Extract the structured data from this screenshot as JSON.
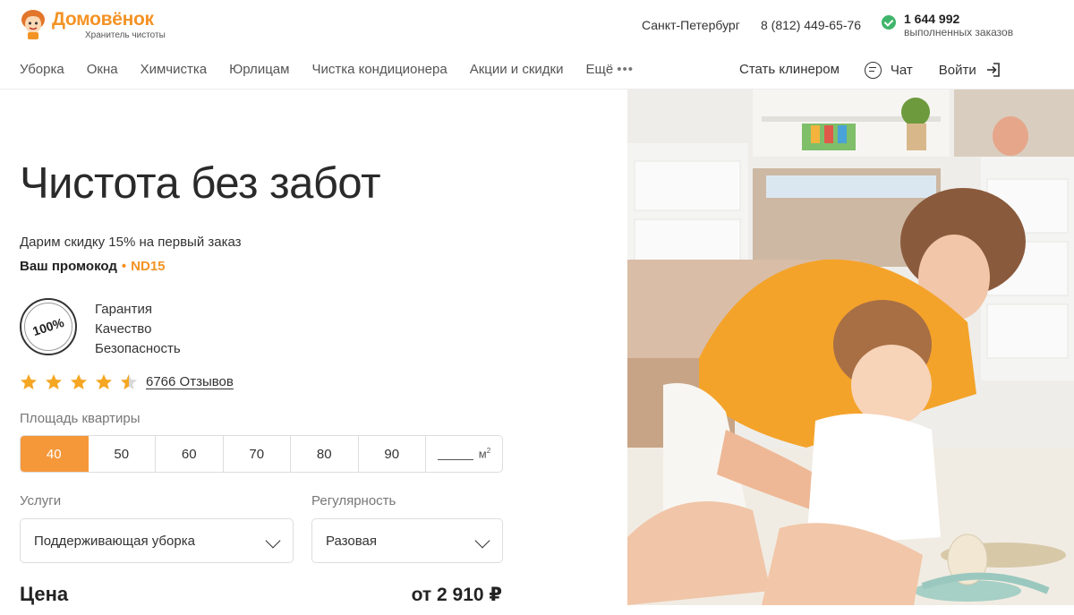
{
  "header": {
    "logo_name": "Домовёнок",
    "logo_tagline": "Хранитель чистоты",
    "city": "Санкт-Петербург",
    "phone": "8 (812) 449-65-76",
    "orders_count": "1 644 992",
    "orders_label": "выполненных заказов"
  },
  "nav": {
    "items": [
      "Уборка",
      "Окна",
      "Химчистка",
      "Юрлицам",
      "Чистка кондиционера",
      "Акции и скидки"
    ],
    "more_label": "Ещё",
    "become_cleaner": "Стать клинером",
    "chat": "Чат",
    "login": "Войти"
  },
  "hero": {
    "title": "Чистота без забот",
    "discount_text": "Дарим скидку 15% на первый заказ",
    "promo_label": "Ваш промокод",
    "promo_code": "ND15",
    "badge_text": "100%",
    "guarantees": [
      "Гарантия",
      "Качество",
      "Безопасность"
    ],
    "rating_stars": 4.5,
    "reviews_link": "6766 Отзывов"
  },
  "calculator": {
    "area_label": "Площадь квартиры",
    "area_options": [
      "40",
      "50",
      "60",
      "70",
      "80",
      "90"
    ],
    "area_selected": "40",
    "area_unit": "м",
    "services_label": "Услуги",
    "services_value": "Поддерживающая уборка",
    "regularity_label": "Регулярность",
    "regularity_value": "Разовая",
    "price_label": "Цена",
    "price_value": "от 2 910 ₽"
  },
  "colors": {
    "accent": "#f39325",
    "active_segment": "#f5983a",
    "check_green": "#3fb56b"
  }
}
